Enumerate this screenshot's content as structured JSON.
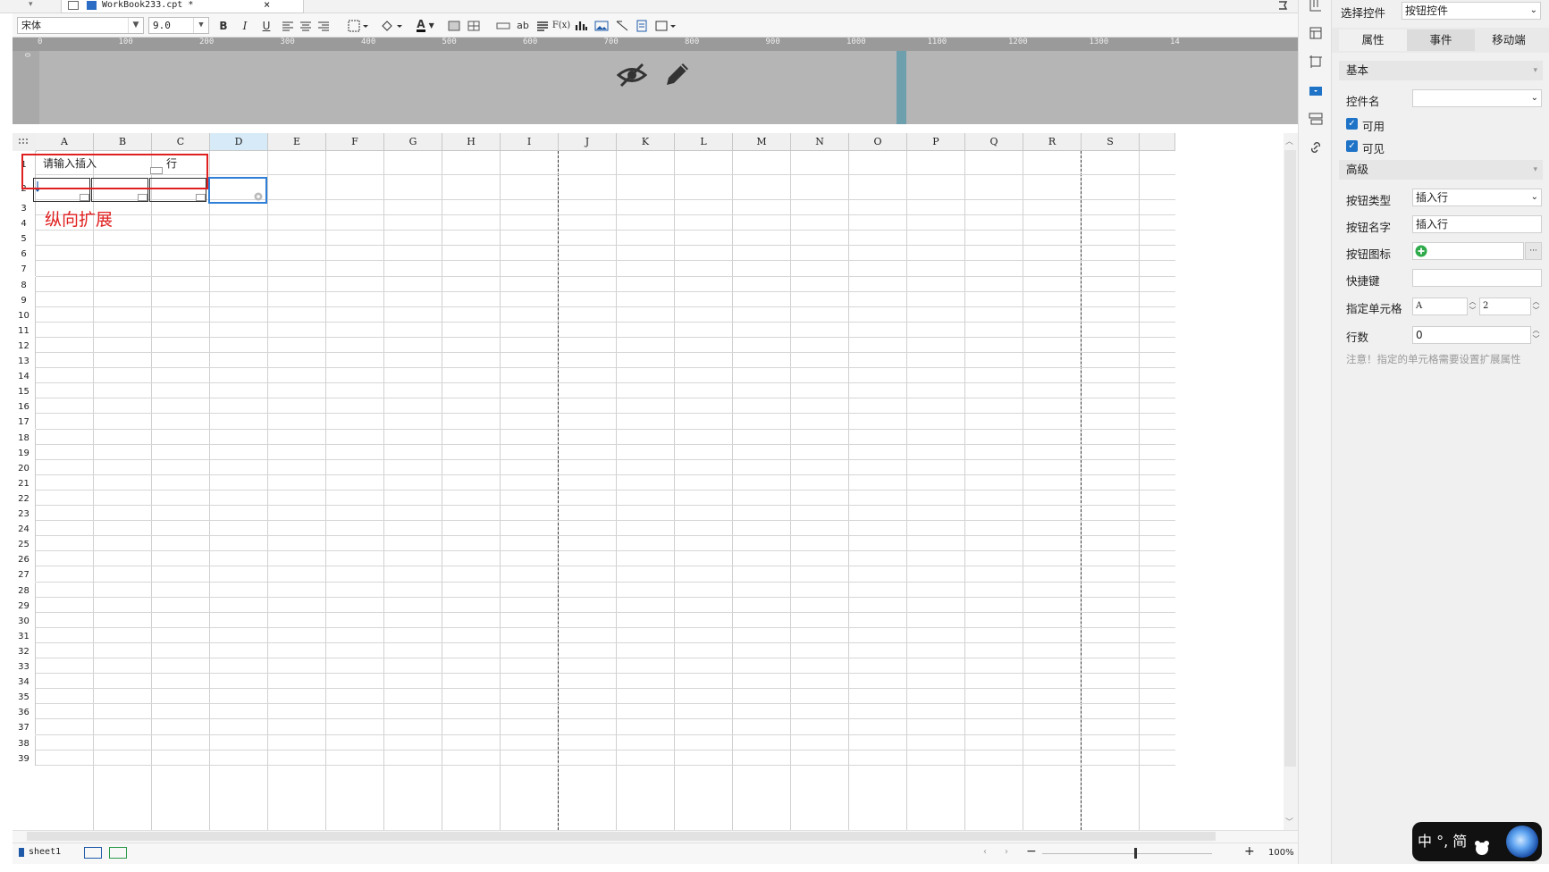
{
  "tab": {
    "title": "WorkBook233.cpt *",
    "close": "×",
    "dropdown": "▾"
  },
  "toolbar": {
    "font_name": "宋体",
    "font_size": "9.0",
    "bold": "B",
    "italic": "I",
    "underline": "U",
    "font_color_glyph": "A",
    "text_glyph": "ab",
    "formula_glyph": "F(x)"
  },
  "ruler": {
    "ticks": [
      "0",
      "100",
      "200",
      "300",
      "400",
      "500",
      "600",
      "700",
      "800",
      "900",
      "1000",
      "1100",
      "1200",
      "1300",
      "14"
    ]
  },
  "sheet": {
    "columns": [
      "A",
      "B",
      "C",
      "D",
      "E",
      "F",
      "G",
      "H",
      "I",
      "J",
      "K",
      "L",
      "M",
      "N",
      "O",
      "P",
      "Q",
      "R",
      "S"
    ],
    "selected_column": "D",
    "rows": [
      "1",
      "2",
      "3",
      "4",
      "5",
      "6",
      "7",
      "8",
      "9",
      "10",
      "11",
      "12",
      "13",
      "14",
      "15",
      "16",
      "17",
      "18",
      "19",
      "20",
      "21",
      "22",
      "23",
      "24",
      "25",
      "26",
      "27",
      "28",
      "29",
      "30",
      "31",
      "32",
      "33",
      "34",
      "35",
      "36",
      "37",
      "38",
      "39"
    ],
    "cell_a1": "请输入插入",
    "cell_c1": "行",
    "annotation": "纵向扩展"
  },
  "status": {
    "sheet_name": "sheet1",
    "zoom": "100%",
    "minus": "−",
    "plus": "+"
  },
  "panel": {
    "select_label": "选择控件",
    "select_value": "按钮控件",
    "tabs": [
      "属性",
      "事件",
      "移动端"
    ],
    "basic_section": "基本",
    "control_name_label": "控件名",
    "control_name_value": "",
    "enabled_label": "可用",
    "visible_label": "可见",
    "advanced_section": "高级",
    "button_type_label": "按钮类型",
    "button_type_value": "插入行",
    "button_name_label": "按钮名字",
    "button_name_value": "插入行",
    "button_icon_label": "按钮图标",
    "button_icon_more": "···",
    "shortcut_label": "快捷键",
    "shortcut_value": "",
    "target_cell_label": "指定单元格",
    "target_col": "A",
    "target_row": "2",
    "rows_label": "行数",
    "rows_value": "0",
    "note": "注意！指定的单元格需要设置扩展属性"
  },
  "ime": {
    "text": "中 °, 简"
  },
  "colors": {
    "accent": "#1e73c7",
    "selection": "#2f7fd8",
    "annotation": "#e02020",
    "panel_bg": "#f0f0f0"
  }
}
